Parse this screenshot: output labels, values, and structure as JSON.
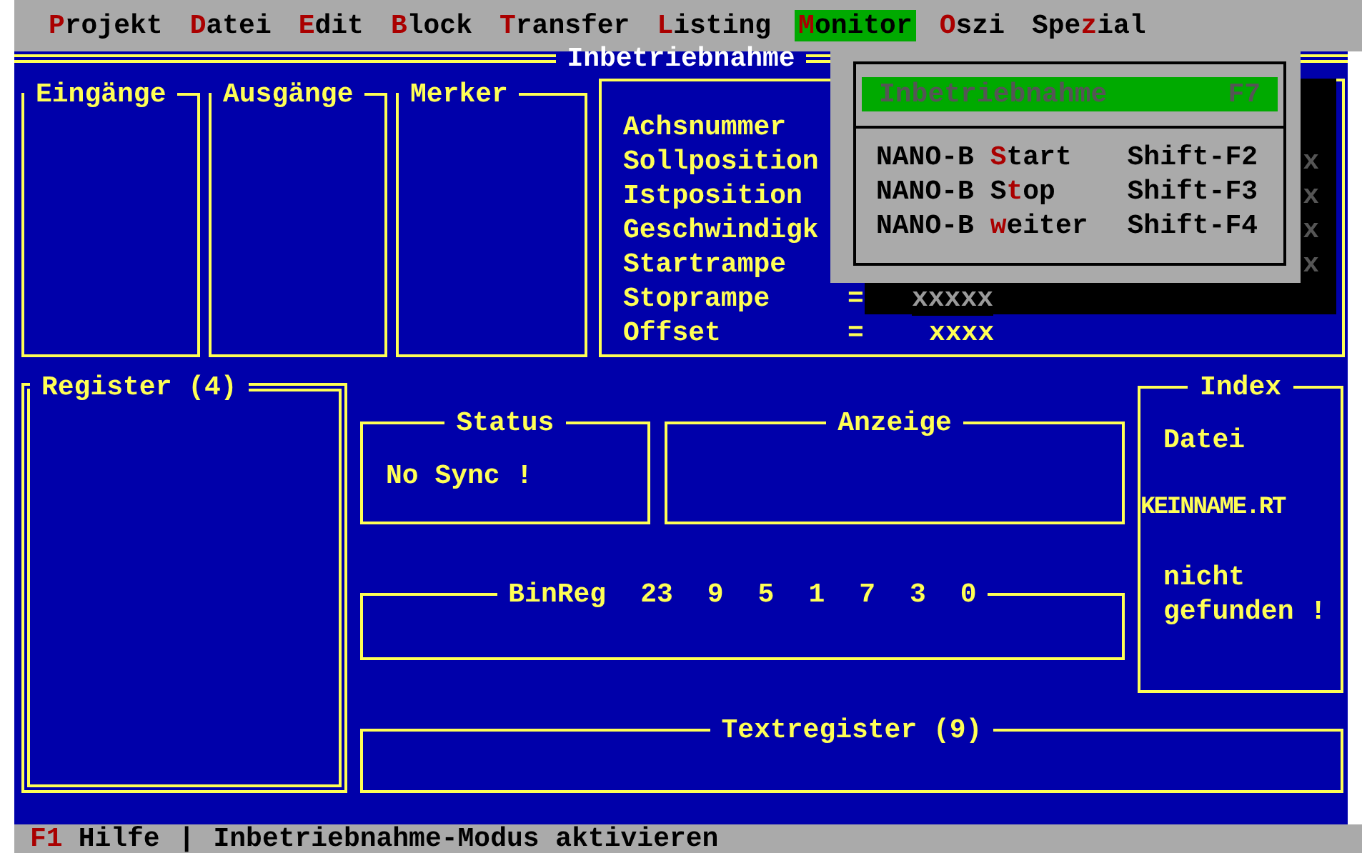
{
  "menu_bar": [
    {
      "key": "P",
      "post": "rojekt",
      "selected": false
    },
    {
      "key": "D",
      "post": "atei",
      "selected": false
    },
    {
      "key": "E",
      "post": "dit",
      "selected": false
    },
    {
      "key": "B",
      "post": "lock",
      "selected": false
    },
    {
      "key": "T",
      "post": "ransfer",
      "selected": false
    },
    {
      "key": "L",
      "post": "isting",
      "selected": false
    },
    {
      "key": "M",
      "post": "onitor",
      "selected": true
    },
    {
      "key": "O",
      "post": "szi",
      "selected": false
    },
    {
      "pre": "Spe",
      "key": "z",
      "post": "ial",
      "selected": false
    }
  ],
  "window": {
    "title": "Inbetriebnahme"
  },
  "io_panels": [
    {
      "title": "Eingänge"
    },
    {
      "title": "Ausgänge"
    },
    {
      "title": "Merker"
    }
  ],
  "axis_rows": [
    {
      "label": "Achsnummer"
    },
    {
      "label": "Sollposition",
      "tail": "x"
    },
    {
      "label": "Istposition",
      "tail": "x"
    },
    {
      "label": "Geschwindigk",
      "tail": "x"
    },
    {
      "label": "Startrampe",
      "tail": "x"
    },
    {
      "label": "Stoprampe",
      "equals": "=",
      "value": "xxxxx",
      "shadowed": true
    },
    {
      "label": "Offset",
      "equals": "=",
      "value": "xxxx",
      "shadowed": false
    }
  ],
  "register": {
    "title": "Register (4)"
  },
  "status": {
    "title": "Status",
    "text": "No Sync !"
  },
  "anzeige": {
    "title": "Anzeige"
  },
  "binreg": {
    "title": "BinReg",
    "bits": [
      "23",
      "9",
      "5",
      "1",
      "7",
      "3",
      "0"
    ]
  },
  "index": {
    "title": "Index",
    "label": "Datei",
    "file": "KEINNAME.RT",
    "message": "nicht gefunden !"
  },
  "textregister": {
    "title": "Textregister (9)"
  },
  "dropdown": {
    "items": [
      {
        "kind": "header",
        "pre": "Inbetriebnahme",
        "shortcut": "F7",
        "selected": true,
        "disabled": true
      },
      {
        "kind": "item",
        "pre": "NANO-B ",
        "key": "S",
        "post": "tart",
        "shortcut": "Shift-F2",
        "selected": false,
        "disabled": false
      },
      {
        "kind": "item",
        "pre": "NANO-B S",
        "key": "t",
        "post": "op",
        "shortcut": "Shift-F3",
        "selected": false,
        "disabled": false
      },
      {
        "kind": "item",
        "pre": "NANO-B ",
        "key": "w",
        "post": "eiter",
        "shortcut": "Shift-F4",
        "selected": false,
        "disabled": false
      }
    ]
  },
  "status_bar": {
    "key": "F1",
    "key_label": "Hilfe",
    "separator": "|",
    "message": "Inbetriebnahme-Modus aktivieren"
  }
}
